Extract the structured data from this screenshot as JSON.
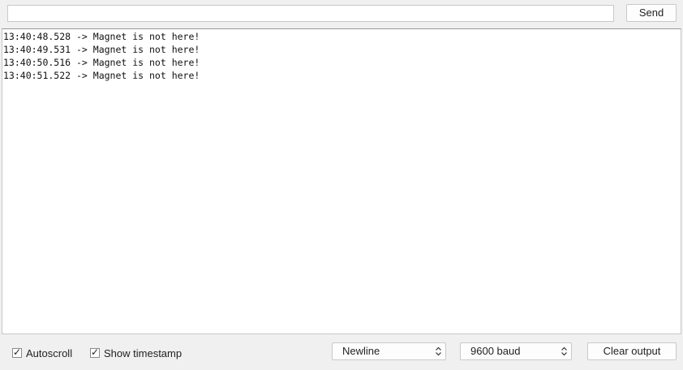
{
  "send_bar": {
    "input_value": "",
    "input_placeholder": "",
    "send_label": "Send"
  },
  "output": {
    "lines": [
      "13:40:48.528 -> Magnet is not here!",
      "13:40:49.531 -> Magnet is not here!",
      "13:40:50.516 -> Magnet is not here!",
      "13:40:51.522 -> Magnet is not here!"
    ]
  },
  "footer": {
    "autoscroll": {
      "label": "Autoscroll",
      "checked": true
    },
    "show_timestamp": {
      "label": "Show timestamp",
      "checked": true
    },
    "line_ending": {
      "selected": "Newline"
    },
    "baud_rate": {
      "selected": "9600 baud"
    },
    "clear_label": "Clear output"
  },
  "icons": {
    "checkmark": "check-icon",
    "select_arrows": "up-down-chevron-icon"
  }
}
